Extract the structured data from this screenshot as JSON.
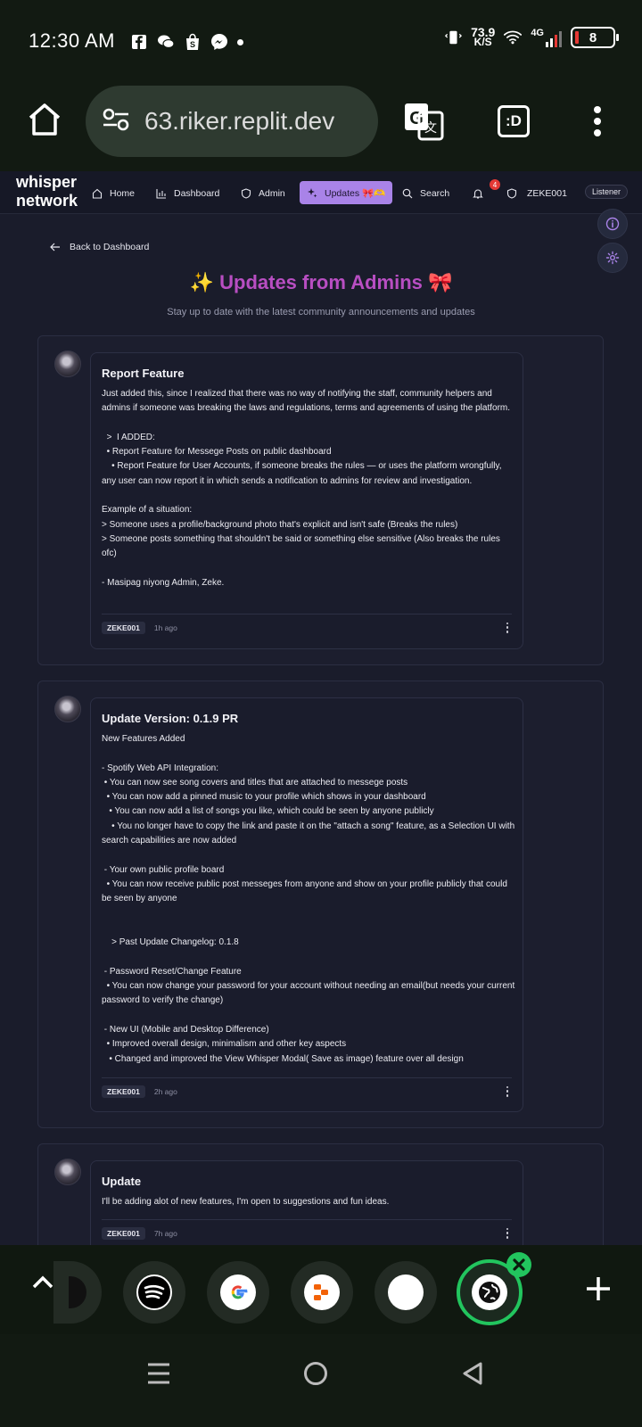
{
  "status_bar": {
    "time": "12:30 AM",
    "net_speed_value": "73.9",
    "net_speed_unit": "K/S",
    "network_type": "4G",
    "battery": "8",
    "notification_icons": [
      "facebook-icon",
      "messenger-chat-icon",
      "shopee-icon",
      "messenger-icon"
    ]
  },
  "browser": {
    "url": "63.riker.replit.dev",
    "tabs_label": ":D"
  },
  "navbar": {
    "brand_line1": "whisper",
    "brand_line2": "network",
    "items": [
      {
        "label": "Home",
        "icon": "home-icon"
      },
      {
        "label": "Dashboard",
        "icon": "chart-icon"
      },
      {
        "label": "Admin",
        "icon": "shield-icon"
      },
      {
        "label": "Updates 🎀🫶",
        "icon": "sparkles-icon"
      },
      {
        "label": "Search",
        "icon": "search-icon"
      }
    ],
    "notification_count": "4",
    "username": "ZEKE001",
    "role": "Listener"
  },
  "page": {
    "back_label": "Back to Dashboard",
    "title": "✨ Updates from Admins 🎀",
    "subtitle": "Stay up to date with the latest community announcements and updates"
  },
  "posts": [
    {
      "title": "Report Feature",
      "body": "Just added this, since I realized that there was no way of notifying the staff, community helpers and admins if someone was breaking the laws and regulations, terms and agreements of using the platform.\n\n  >  I ADDED:\n  • Report Feature for Messege Posts on public dashboard\n    • Report Feature for User Accounts, if someone breaks the rules — or uses the platform wrongfully, any user can now report it in which sends a notification to admins for review and investigation.\n\nExample of a situation:\n> Someone uses a profile/background photo that's explicit and isn't safe (Breaks the rules)\n> Someone posts something that shouldn't be said or something else sensitive (Also breaks the rules ofc)\n\n- Masipag niyong Admin, Zeke.",
      "author": "ZEKE001",
      "time": "1h ago"
    },
    {
      "title": "Update Version: 0.1.9 PR",
      "body": "New Features Added\n\n- Spotify Web API Integration:\n • You can now see song covers and titles that are attached to messege posts\n  • You can now add a pinned music to your profile which shows in your dashboard\n   • You can now add a list of songs you like, which could be seen by anyone publicly\n    • You no longer have to copy the link and paste it on the \"attach a song\" feature, as a Selection UI with search capabilities are now added\n\n - Your own public profile board\n  • You can now receive public post messeges from anyone and show on your profile publicly that could be seen by anyone\n\n\n    > Past Update Changelog: 0.1.8\n\n - Password Reset/Change Feature\n  • You can now change your password for your account without needing an email(but needs your current password to verify the change)\n\n - New UI (Mobile and Desktop Difference)\n  • Improved overall design, minimalism and other key aspects\n   • Changed and improved the View Whisper Modal( Save as image) feature over all design",
      "author": "ZEKE001",
      "time": "2h ago"
    },
    {
      "title": "Update",
      "body": "I'll be adding alot of new features, I'm open to suggestions and fun ideas.",
      "author": "ZEKE001",
      "time": "7h ago"
    }
  ],
  "tab_switcher": {
    "tabs": [
      "partial-tab-icon",
      "spotify-icon",
      "google-icon",
      "app-icon",
      "blank-tab-icon",
      "globe-icon"
    ],
    "accent": "#22c55e"
  },
  "colors": {
    "accent_purple": "#a983e8",
    "title_magenta": "#b84ec2",
    "background": "#1a1c2b"
  }
}
